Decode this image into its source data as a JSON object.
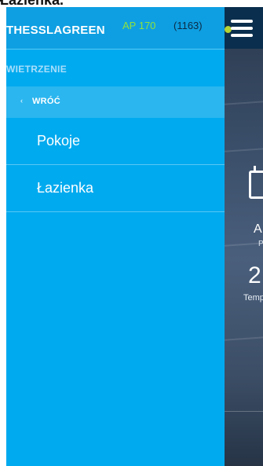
{
  "top_caption": "Łazienka.",
  "drawer": {
    "brand": "THESSLAGREEN",
    "model": "AP 170",
    "serial": "(1163)",
    "section_title": "WIETRZENIE",
    "back": {
      "chevron": "‹",
      "label": "WRÓĆ"
    },
    "items": [
      {
        "label": "Pokoje"
      },
      {
        "label": "Łazienka"
      }
    ]
  },
  "background_app": {
    "status_color": "#b5d334",
    "big_letter": "A",
    "small_letter": "P",
    "big_number": "2",
    "temp_label": "Temp",
    "back_arrow": "←"
  },
  "colors": {
    "drawer_bg": "#00aaef",
    "header_bg": "#0e9fe2",
    "model_text": "#8ee13e",
    "serial_text": "#0b2c46"
  }
}
